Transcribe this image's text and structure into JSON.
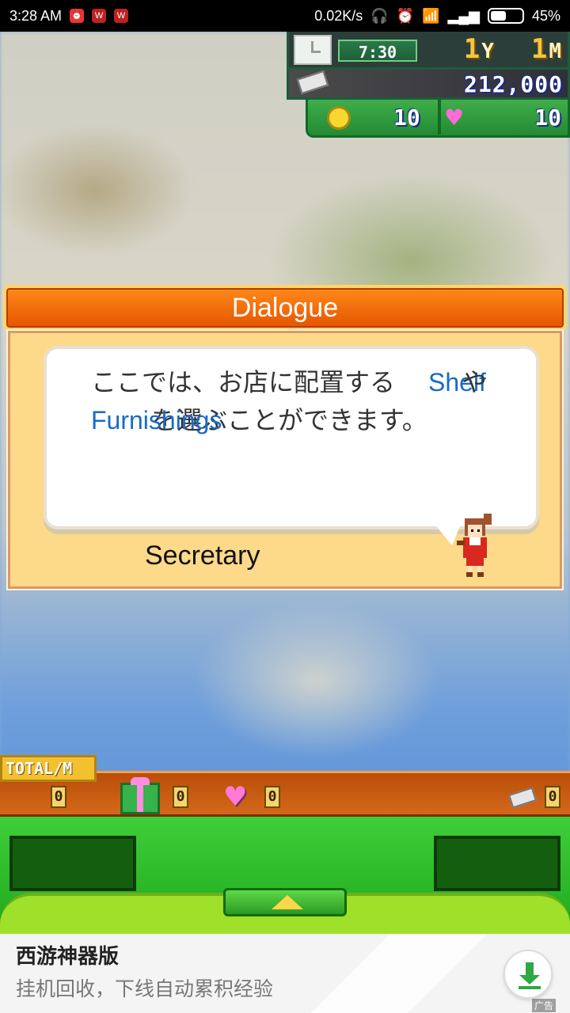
{
  "status_bar": {
    "time": "3:28 AM",
    "network_speed": "0.02K/s",
    "battery": "45%"
  },
  "hud": {
    "clock_time": "7:30",
    "year": "1",
    "year_unit": "Y",
    "month": "1",
    "month_unit": "M",
    "money": "212,000",
    "coins": "10",
    "hearts": "10"
  },
  "dialogue": {
    "title": "Dialogue",
    "line1_text": "ここでは、お店に配置する",
    "line1_link": "Shelf",
    "line1_suffix": "や",
    "line2_link": "Furnishings",
    "line2_text": "を選ぶことができます。",
    "speaker": "Secretary"
  },
  "total_bar": {
    "label": "TOTAL/M",
    "coin_total": "0",
    "gift_total": "0",
    "heart_total": "0",
    "ticket_total": "0"
  },
  "ad": {
    "title": "西游神器版",
    "subtitle": "挂机回收，下线自动累积经验",
    "tag": "广告"
  }
}
